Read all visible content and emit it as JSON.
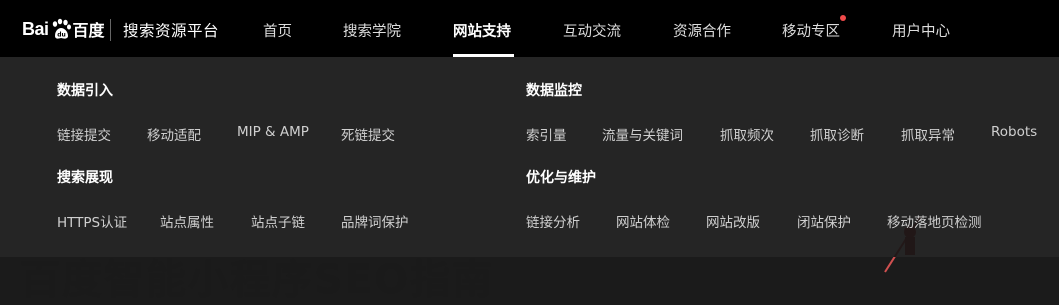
{
  "logo": {
    "bai": "Bai",
    "du": "百度",
    "subtitle": "搜索资源平台"
  },
  "nav": {
    "items": [
      {
        "label": "首页"
      },
      {
        "label": "搜索学院"
      },
      {
        "label": "网站支持",
        "active": true
      },
      {
        "label": "互动交流"
      },
      {
        "label": "资源合作"
      },
      {
        "label": "移动专区",
        "badge_dot": true
      },
      {
        "label": "用户中心"
      }
    ]
  },
  "dropdown": {
    "sections": [
      {
        "title": "数据引入",
        "links": [
          "链接提交",
          "移动适配",
          "MIP & AMP",
          "死链提交"
        ]
      },
      {
        "title": "数据监控",
        "links": [
          "索引量",
          "流量与关键词",
          "抓取频次",
          "抓取诊断",
          "抓取异常",
          "Robots"
        ]
      },
      {
        "title": "搜索展现",
        "links": [
          "HTTPS认证",
          "站点属性",
          "站点子链",
          "品牌词保护"
        ]
      },
      {
        "title": "优化与维护",
        "links": [
          "链接分析",
          "网站体检",
          "网站改版",
          "闭站保护",
          "移动落地页检测"
        ]
      }
    ]
  },
  "background": {
    "headline": "百度智能小程序SEO指南"
  },
  "colors": {
    "topbar": "#000000",
    "dropdown": "#141414",
    "badge_dot": "#f04a4a",
    "link": "#cfcfcf"
  }
}
